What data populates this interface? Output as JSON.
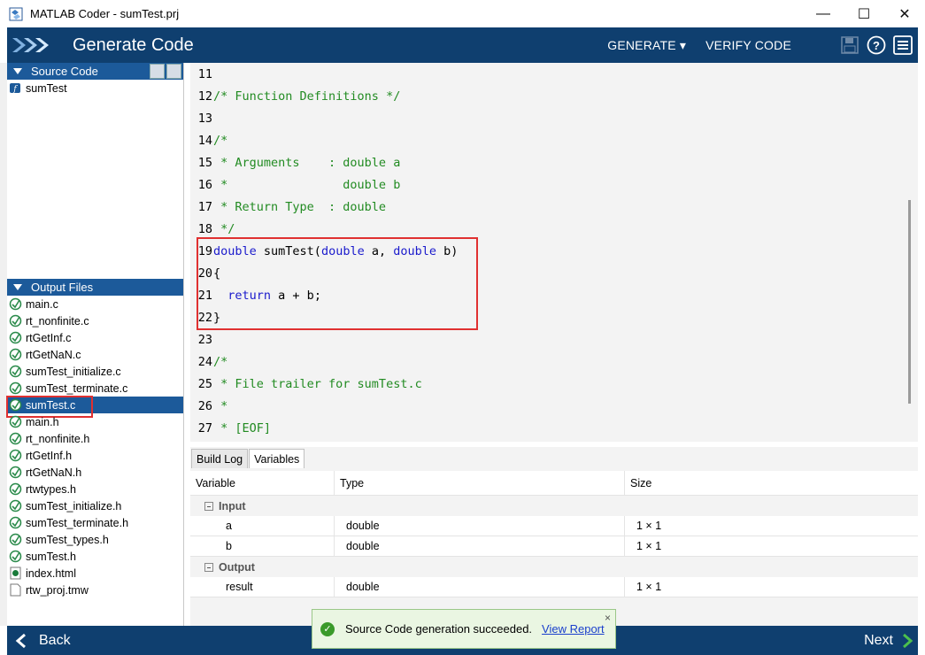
{
  "window": {
    "title": "MATLAB Coder - sumTest.prj",
    "minimize": "—",
    "maximize": "☐",
    "close": "✕"
  },
  "header": {
    "title": "Generate Code",
    "generate_menu": "GENERATE ▾",
    "verify_code": "VERIFY CODE",
    "help_icon": "?"
  },
  "source_panel": {
    "title": "Source Code",
    "items": [
      {
        "label": "sumTest"
      }
    ]
  },
  "output_panel": {
    "title": "Output Files",
    "files": [
      {
        "label": "main.c"
      },
      {
        "label": "rt_nonfinite.c"
      },
      {
        "label": "rtGetInf.c"
      },
      {
        "label": "rtGetNaN.c"
      },
      {
        "label": "sumTest_initialize.c"
      },
      {
        "label": "sumTest_terminate.c"
      },
      {
        "label": "sumTest.c",
        "selected": true
      },
      {
        "label": "main.h"
      },
      {
        "label": "rt_nonfinite.h"
      },
      {
        "label": "rtGetInf.h"
      },
      {
        "label": "rtGetNaN.h"
      },
      {
        "label": "rtwtypes.h"
      },
      {
        "label": "sumTest_initialize.h"
      },
      {
        "label": "sumTest_terminate.h"
      },
      {
        "label": "sumTest_types.h"
      },
      {
        "label": "sumTest.h"
      },
      {
        "label": "index.html"
      },
      {
        "label": "rtw_proj.tmw"
      }
    ]
  },
  "code": {
    "lines": [
      {
        "n": "11",
        "segments": []
      },
      {
        "n": "12",
        "segments": [
          {
            "t": "/* Function Definitions */",
            "c": "cm"
          }
        ]
      },
      {
        "n": "13",
        "segments": []
      },
      {
        "n": "14",
        "segments": [
          {
            "t": "/*",
            "c": "cm"
          }
        ]
      },
      {
        "n": "15",
        "segments": [
          {
            "t": " * Arguments    : double a",
            "c": "cm"
          }
        ]
      },
      {
        "n": "16",
        "segments": [
          {
            "t": " *                double b",
            "c": "cm"
          }
        ]
      },
      {
        "n": "17",
        "segments": [
          {
            "t": " * Return Type  : double",
            "c": "cm"
          }
        ]
      },
      {
        "n": "18",
        "segments": [
          {
            "t": " */",
            "c": "cm"
          }
        ]
      },
      {
        "n": "19",
        "segments": [
          {
            "t": "double",
            "c": "kw"
          },
          {
            "t": " sumTest(",
            "c": "tx"
          },
          {
            "t": "double",
            "c": "kw"
          },
          {
            "t": " a, ",
            "c": "tx"
          },
          {
            "t": "double",
            "c": "kw"
          },
          {
            "t": " b)",
            "c": "tx"
          }
        ]
      },
      {
        "n": "20",
        "segments": [
          {
            "t": "{",
            "c": "tx"
          }
        ]
      },
      {
        "n": "21",
        "segments": [
          {
            "t": "  ",
            "c": "tx"
          },
          {
            "t": "return",
            "c": "kw"
          },
          {
            "t": " a + b;",
            "c": "tx"
          }
        ]
      },
      {
        "n": "22",
        "segments": [
          {
            "t": "}",
            "c": "tx"
          }
        ]
      },
      {
        "n": "23",
        "segments": []
      },
      {
        "n": "24",
        "segments": [
          {
            "t": "/*",
            "c": "cm"
          }
        ]
      },
      {
        "n": "25",
        "segments": [
          {
            "t": " * File trailer for sumTest.c",
            "c": "cm"
          }
        ]
      },
      {
        "n": "26",
        "segments": [
          {
            "t": " *",
            "c": "cm"
          }
        ]
      },
      {
        "n": "27",
        "segments": [
          {
            "t": " * [EOF]",
            "c": "cm"
          }
        ]
      }
    ]
  },
  "bottom_tabs": [
    {
      "label": "Build Log",
      "active": false
    },
    {
      "label": "Variables",
      "active": true
    }
  ],
  "variables": {
    "columns": {
      "variable": "Variable",
      "type": "Type",
      "size": "Size"
    },
    "groups": [
      {
        "name": "Input",
        "rows": [
          {
            "variable": "a",
            "type": "double",
            "size": "1 × 1"
          },
          {
            "variable": "b",
            "type": "double",
            "size": "1 × 1"
          }
        ]
      },
      {
        "name": "Output",
        "rows": [
          {
            "variable": "result",
            "type": "double",
            "size": "1 × 1"
          }
        ]
      }
    ]
  },
  "footer": {
    "back": "Back",
    "next": "Next"
  },
  "toast": {
    "message": "Source Code generation succeeded.",
    "link": "View Report",
    "close": "×"
  },
  "colors": {
    "header_bg": "#0f3f6f",
    "panel_head": "#1c5a9a",
    "comment": "#228b22",
    "keyword": "#1a1acc",
    "highlight_box": "#e03030"
  }
}
